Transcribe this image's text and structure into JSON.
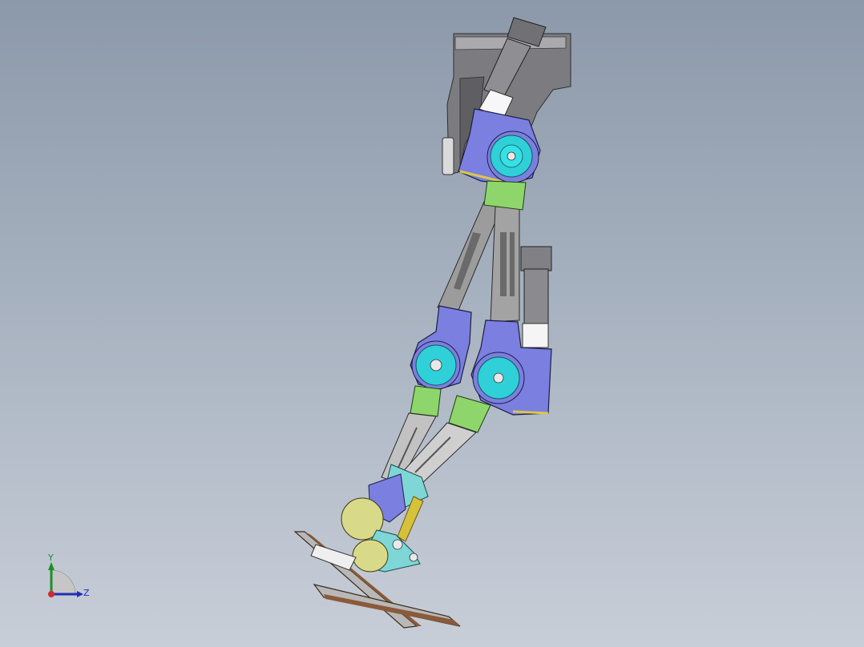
{
  "viewport": {
    "background_top": "#8c99aa",
    "background_bottom": "#c8ced8"
  },
  "model": {
    "colors": {
      "frame_dark": "#6e6e72",
      "frame_mid": "#9a9aa0",
      "frame_light": "#c7c7cc",
      "motor_body": "#7b7fe0",
      "hub": "#2fd0d8",
      "hub_dark": "#1a9aa8",
      "bracket_green": "#8ed66c",
      "bracket_cyan": "#7ed7d6",
      "link_gray": "#9c9c9c",
      "actuator_white": "#f4f4f4",
      "foot_pad": "#d9d98a",
      "spring": "#d6c23a",
      "plate_edge": "#8a5a3a"
    }
  },
  "triad": {
    "y_label": "Y",
    "z_label": "Z",
    "x_color": "#d22a2a",
    "y_color": "#1c8f2a",
    "z_color": "#1f2fb8"
  }
}
